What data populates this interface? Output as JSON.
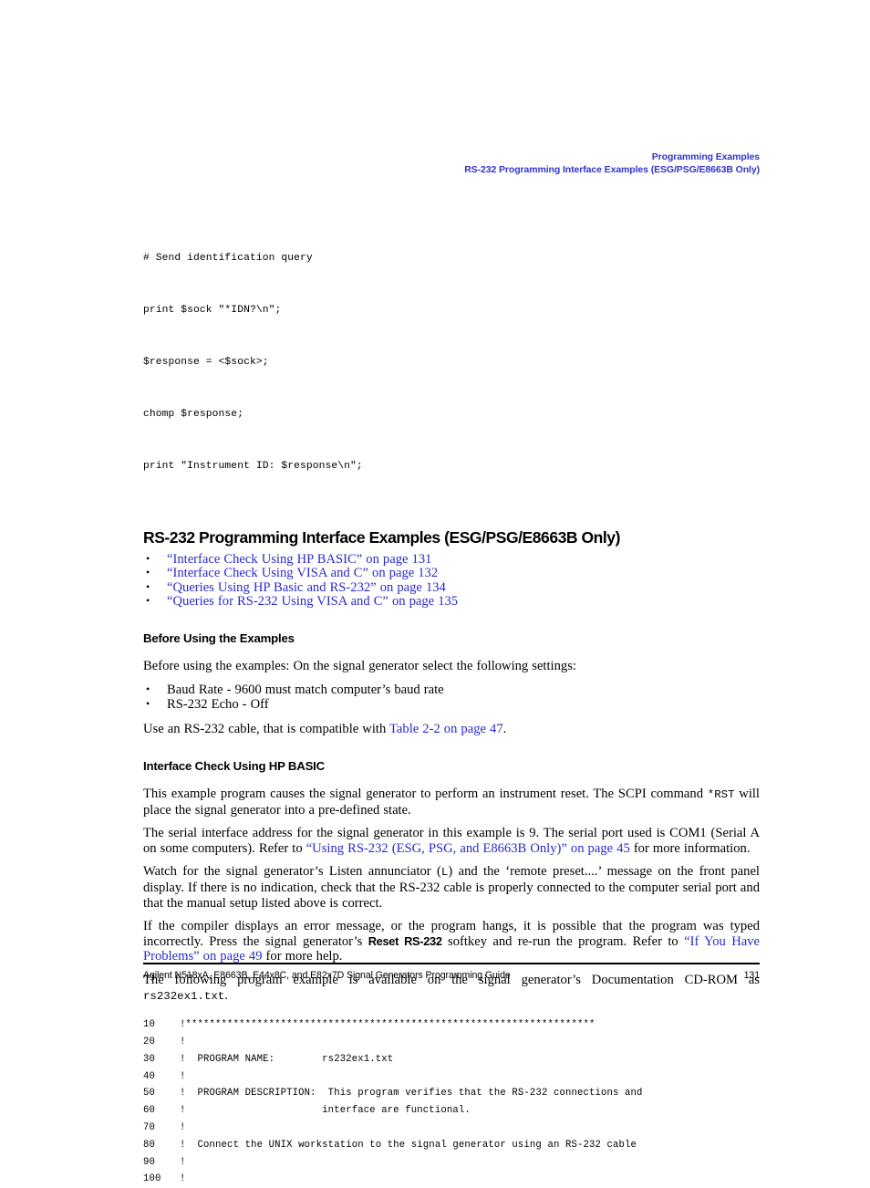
{
  "running_header": {
    "line1": "Programming Examples",
    "line2": "RS-232 Programming Interface Examples (ESG/PSG/E8663B Only)",
    "color": "#3333cc"
  },
  "top_code": {
    "lines": [
      "# Send identification query",
      "print $sock \"*IDN?\\n\";",
      "$response = <$sock>;",
      "chomp $response;",
      "print \"Instrument ID: $response\\n\";"
    ]
  },
  "section": {
    "heading": "RS-232 Programming Interface Examples (ESG/PSG/E8663B Only)",
    "links": [
      "“Interface Check Using HP BASIC” on page 131",
      "“Interface Check Using VISA and C” on page 132",
      "“Queries Using HP Basic and RS-232” on page 134",
      "“Queries for RS-232 Using VISA and C” on page 135"
    ],
    "link_color": "#2a2aca"
  },
  "before_using": {
    "heading": "Before Using the Examples",
    "intro": "Before using the examples: On the signal generator select the following settings:",
    "bullets": [
      "Baud Rate - 9600 must match computer’s baud rate",
      "RS-232 Echo - Off"
    ],
    "cable_text_before": "Use an RS-232 cable, that is compatible with ",
    "cable_link": "Table 2-2 on page 47",
    "cable_text_after": "."
  },
  "interface_check": {
    "heading": "Interface Check Using HP BASIC",
    "para1_a": "This example program causes the signal generator to perform an instrument reset. The SCPI command ",
    "para1_code": "*RST",
    "para1_b": " will place the signal generator into a pre-defined state.",
    "para2_a": "The serial interface address for the signal generator in this example is 9. The serial port used is COM1 (Serial A on some computers). Refer to ",
    "para2_link": "“Using RS-232 (ESG, PSG, and E8663B Only)” on page 45",
    "para2_b": " for more information.",
    "para3_a": "Watch for the signal generator’s Listen annunciator (",
    "para3_code": "L",
    "para3_b": ") and the ‘remote preset....’ message on the front panel display. If there is no indication, check that the RS-232 cable is properly connected to the computer serial port and that the manual setup listed above is correct.",
    "para4_a": "If the compiler displays an error message, or the program hangs, it is possible that the program was typed incorrectly. Press the signal generator’s ",
    "para4_softkey": "Reset RS-232",
    "para4_b": " softkey and re-run the program. Refer to ",
    "para4_link": "“If You Have Problems” on page 49",
    "para4_c": " for more help.",
    "para5_a": "The following program example is available on the signal generator’s Documentation CD-ROM as ",
    "para5_code": "rs232ex1.txt",
    "para5_b": "."
  },
  "listing": {
    "rows": [
      {
        "no": "10",
        "code": "!*********************************************************************"
      },
      {
        "no": "20",
        "code": "!"
      },
      {
        "no": "30",
        "code": "!  PROGRAM NAME:        rs232ex1.txt"
      },
      {
        "no": "40",
        "code": "!"
      },
      {
        "no": "50",
        "code": "!  PROGRAM DESCRIPTION:  This program verifies that the RS-232 connections and"
      },
      {
        "no": "60",
        "code": "!                       interface are functional."
      },
      {
        "no": "70",
        "code": "!"
      },
      {
        "no": "80",
        "code": "!  Connect the UNIX workstation to the signal generator using an RS-232 cable"
      },
      {
        "no": "90",
        "code": "!"
      },
      {
        "no": "100",
        "code": "!"
      }
    ]
  },
  "footer": {
    "title": "Agilent N518xA, E8663B, E44x8C, and E82x7D Signal Generators Programming Guide",
    "page": "131"
  }
}
